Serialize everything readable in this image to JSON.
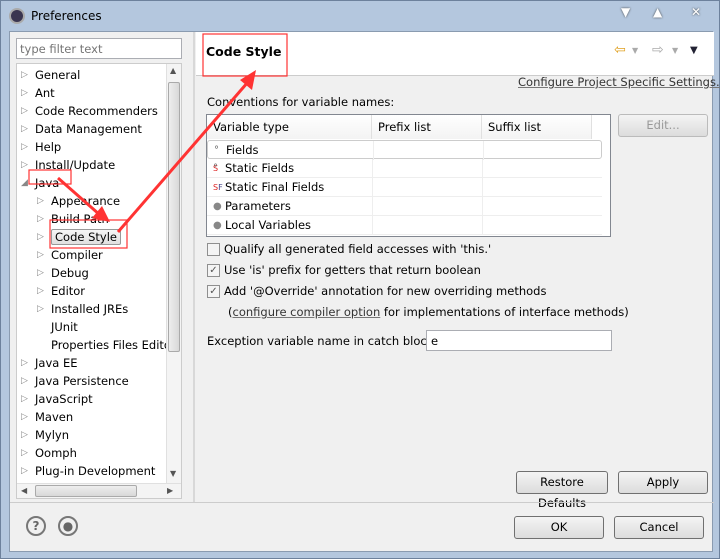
{
  "window": {
    "title": "Preferences"
  },
  "filter": {
    "placeholder": "type filter text"
  },
  "tree": [
    {
      "label": "General",
      "level": 0,
      "twisty": "closed"
    },
    {
      "label": "Ant",
      "level": 0,
      "twisty": "closed"
    },
    {
      "label": "Code Recommenders",
      "level": 0,
      "twisty": "closed"
    },
    {
      "label": "Data Management",
      "level": 0,
      "twisty": "closed"
    },
    {
      "label": "Help",
      "level": 0,
      "twisty": "closed"
    },
    {
      "label": "Install/Update",
      "level": 0,
      "twisty": "closed"
    },
    {
      "label": "Java",
      "level": 0,
      "twisty": "open"
    },
    {
      "label": "Appearance",
      "level": 1,
      "twisty": "closed"
    },
    {
      "label": "Build Path",
      "level": 1,
      "twisty": "closed"
    },
    {
      "label": "Code Style",
      "level": 1,
      "twisty": "closed",
      "selected": true
    },
    {
      "label": "Compiler",
      "level": 1,
      "twisty": "closed"
    },
    {
      "label": "Debug",
      "level": 1,
      "twisty": "closed"
    },
    {
      "label": "Editor",
      "level": 1,
      "twisty": "closed"
    },
    {
      "label": "Installed JREs",
      "level": 1,
      "twisty": "closed"
    },
    {
      "label": "JUnit",
      "level": 1,
      "twisty": "none"
    },
    {
      "label": "Properties Files Editor",
      "level": 1,
      "twisty": "none"
    },
    {
      "label": "Java EE",
      "level": 0,
      "twisty": "closed"
    },
    {
      "label": "Java Persistence",
      "level": 0,
      "twisty": "closed"
    },
    {
      "label": "JavaScript",
      "level": 0,
      "twisty": "closed"
    },
    {
      "label": "Maven",
      "level": 0,
      "twisty": "closed"
    },
    {
      "label": "Mylyn",
      "level": 0,
      "twisty": "closed"
    },
    {
      "label": "Oomph",
      "level": 0,
      "twisty": "closed"
    },
    {
      "label": "Plug-in Development",
      "level": 0,
      "twisty": "closed"
    }
  ],
  "page": {
    "title": "Code Style",
    "configure_link": "Configure Project Specific Settings...",
    "conventions_label": "Conventions for variable names:",
    "columns": [
      "Variable type",
      "Prefix list",
      "Suffix list"
    ],
    "rows": [
      {
        "icon": "field-icon",
        "label": "Fields",
        "prefix": "",
        "suffix": ""
      },
      {
        "icon": "static-field-icon",
        "label": "Static Fields",
        "prefix": "",
        "suffix": ""
      },
      {
        "icon": "static-final-field-icon",
        "label": "Static Final Fields",
        "prefix": "",
        "suffix": ""
      },
      {
        "icon": "parameter-icon",
        "label": "Parameters",
        "prefix": "",
        "suffix": ""
      },
      {
        "icon": "local-variable-icon",
        "label": "Local Variables",
        "prefix": "",
        "suffix": ""
      }
    ],
    "edit_button": "Edit...",
    "options": [
      {
        "label": "Qualify all generated field accesses with 'this.'",
        "checked": false
      },
      {
        "label": "Use 'is' prefix for getters that return boolean",
        "checked": true
      },
      {
        "label": "Add '@Override' annotation for new overriding methods",
        "checked": true
      }
    ],
    "note_open": "(",
    "note_link": "configure compiler option",
    "note_rest": " for implementations of interface methods)",
    "exception_label": "Exception variable name in catch blocks:",
    "exception_value": "e",
    "restore_defaults": "Restore Defaults",
    "apply": "Apply"
  },
  "footer": {
    "ok": "OK",
    "cancel": "Cancel"
  },
  "colors": {
    "annotation": "#ff3333",
    "titlebar": "#b4c7de"
  }
}
